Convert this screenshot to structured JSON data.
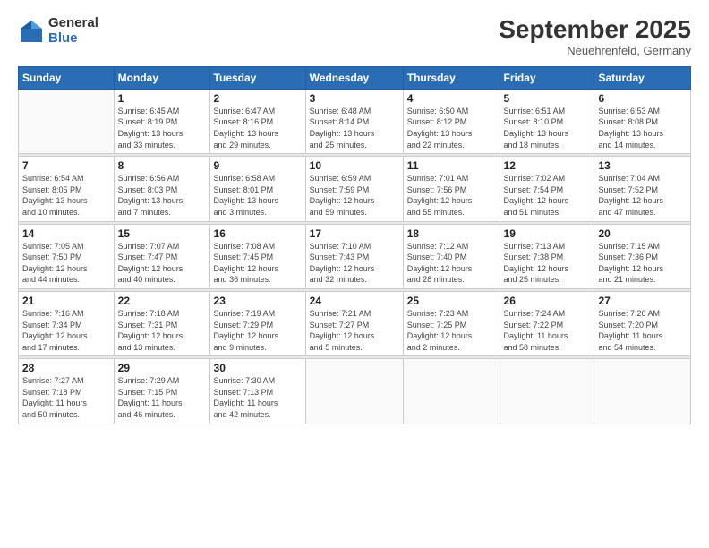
{
  "logo": {
    "general": "General",
    "blue": "Blue"
  },
  "title": "September 2025",
  "location": "Neuehrenfeld, Germany",
  "days_header": [
    "Sunday",
    "Monday",
    "Tuesday",
    "Wednesday",
    "Thursday",
    "Friday",
    "Saturday"
  ],
  "weeks": [
    [
      {
        "day": "",
        "info": ""
      },
      {
        "day": "1",
        "info": "Sunrise: 6:45 AM\nSunset: 8:19 PM\nDaylight: 13 hours\nand 33 minutes."
      },
      {
        "day": "2",
        "info": "Sunrise: 6:47 AM\nSunset: 8:16 PM\nDaylight: 13 hours\nand 29 minutes."
      },
      {
        "day": "3",
        "info": "Sunrise: 6:48 AM\nSunset: 8:14 PM\nDaylight: 13 hours\nand 25 minutes."
      },
      {
        "day": "4",
        "info": "Sunrise: 6:50 AM\nSunset: 8:12 PM\nDaylight: 13 hours\nand 22 minutes."
      },
      {
        "day": "5",
        "info": "Sunrise: 6:51 AM\nSunset: 8:10 PM\nDaylight: 13 hours\nand 18 minutes."
      },
      {
        "day": "6",
        "info": "Sunrise: 6:53 AM\nSunset: 8:08 PM\nDaylight: 13 hours\nand 14 minutes."
      }
    ],
    [
      {
        "day": "7",
        "info": "Sunrise: 6:54 AM\nSunset: 8:05 PM\nDaylight: 13 hours\nand 10 minutes."
      },
      {
        "day": "8",
        "info": "Sunrise: 6:56 AM\nSunset: 8:03 PM\nDaylight: 13 hours\nand 7 minutes."
      },
      {
        "day": "9",
        "info": "Sunrise: 6:58 AM\nSunset: 8:01 PM\nDaylight: 13 hours\nand 3 minutes."
      },
      {
        "day": "10",
        "info": "Sunrise: 6:59 AM\nSunset: 7:59 PM\nDaylight: 12 hours\nand 59 minutes."
      },
      {
        "day": "11",
        "info": "Sunrise: 7:01 AM\nSunset: 7:56 PM\nDaylight: 12 hours\nand 55 minutes."
      },
      {
        "day": "12",
        "info": "Sunrise: 7:02 AM\nSunset: 7:54 PM\nDaylight: 12 hours\nand 51 minutes."
      },
      {
        "day": "13",
        "info": "Sunrise: 7:04 AM\nSunset: 7:52 PM\nDaylight: 12 hours\nand 47 minutes."
      }
    ],
    [
      {
        "day": "14",
        "info": "Sunrise: 7:05 AM\nSunset: 7:50 PM\nDaylight: 12 hours\nand 44 minutes."
      },
      {
        "day": "15",
        "info": "Sunrise: 7:07 AM\nSunset: 7:47 PM\nDaylight: 12 hours\nand 40 minutes."
      },
      {
        "day": "16",
        "info": "Sunrise: 7:08 AM\nSunset: 7:45 PM\nDaylight: 12 hours\nand 36 minutes."
      },
      {
        "day": "17",
        "info": "Sunrise: 7:10 AM\nSunset: 7:43 PM\nDaylight: 12 hours\nand 32 minutes."
      },
      {
        "day": "18",
        "info": "Sunrise: 7:12 AM\nSunset: 7:40 PM\nDaylight: 12 hours\nand 28 minutes."
      },
      {
        "day": "19",
        "info": "Sunrise: 7:13 AM\nSunset: 7:38 PM\nDaylight: 12 hours\nand 25 minutes."
      },
      {
        "day": "20",
        "info": "Sunrise: 7:15 AM\nSunset: 7:36 PM\nDaylight: 12 hours\nand 21 minutes."
      }
    ],
    [
      {
        "day": "21",
        "info": "Sunrise: 7:16 AM\nSunset: 7:34 PM\nDaylight: 12 hours\nand 17 minutes."
      },
      {
        "day": "22",
        "info": "Sunrise: 7:18 AM\nSunset: 7:31 PM\nDaylight: 12 hours\nand 13 minutes."
      },
      {
        "day": "23",
        "info": "Sunrise: 7:19 AM\nSunset: 7:29 PM\nDaylight: 12 hours\nand 9 minutes."
      },
      {
        "day": "24",
        "info": "Sunrise: 7:21 AM\nSunset: 7:27 PM\nDaylight: 12 hours\nand 5 minutes."
      },
      {
        "day": "25",
        "info": "Sunrise: 7:23 AM\nSunset: 7:25 PM\nDaylight: 12 hours\nand 2 minutes."
      },
      {
        "day": "26",
        "info": "Sunrise: 7:24 AM\nSunset: 7:22 PM\nDaylight: 11 hours\nand 58 minutes."
      },
      {
        "day": "27",
        "info": "Sunrise: 7:26 AM\nSunset: 7:20 PM\nDaylight: 11 hours\nand 54 minutes."
      }
    ],
    [
      {
        "day": "28",
        "info": "Sunrise: 7:27 AM\nSunset: 7:18 PM\nDaylight: 11 hours\nand 50 minutes."
      },
      {
        "day": "29",
        "info": "Sunrise: 7:29 AM\nSunset: 7:15 PM\nDaylight: 11 hours\nand 46 minutes."
      },
      {
        "day": "30",
        "info": "Sunrise: 7:30 AM\nSunset: 7:13 PM\nDaylight: 11 hours\nand 42 minutes."
      },
      {
        "day": "",
        "info": ""
      },
      {
        "day": "",
        "info": ""
      },
      {
        "day": "",
        "info": ""
      },
      {
        "day": "",
        "info": ""
      }
    ]
  ]
}
